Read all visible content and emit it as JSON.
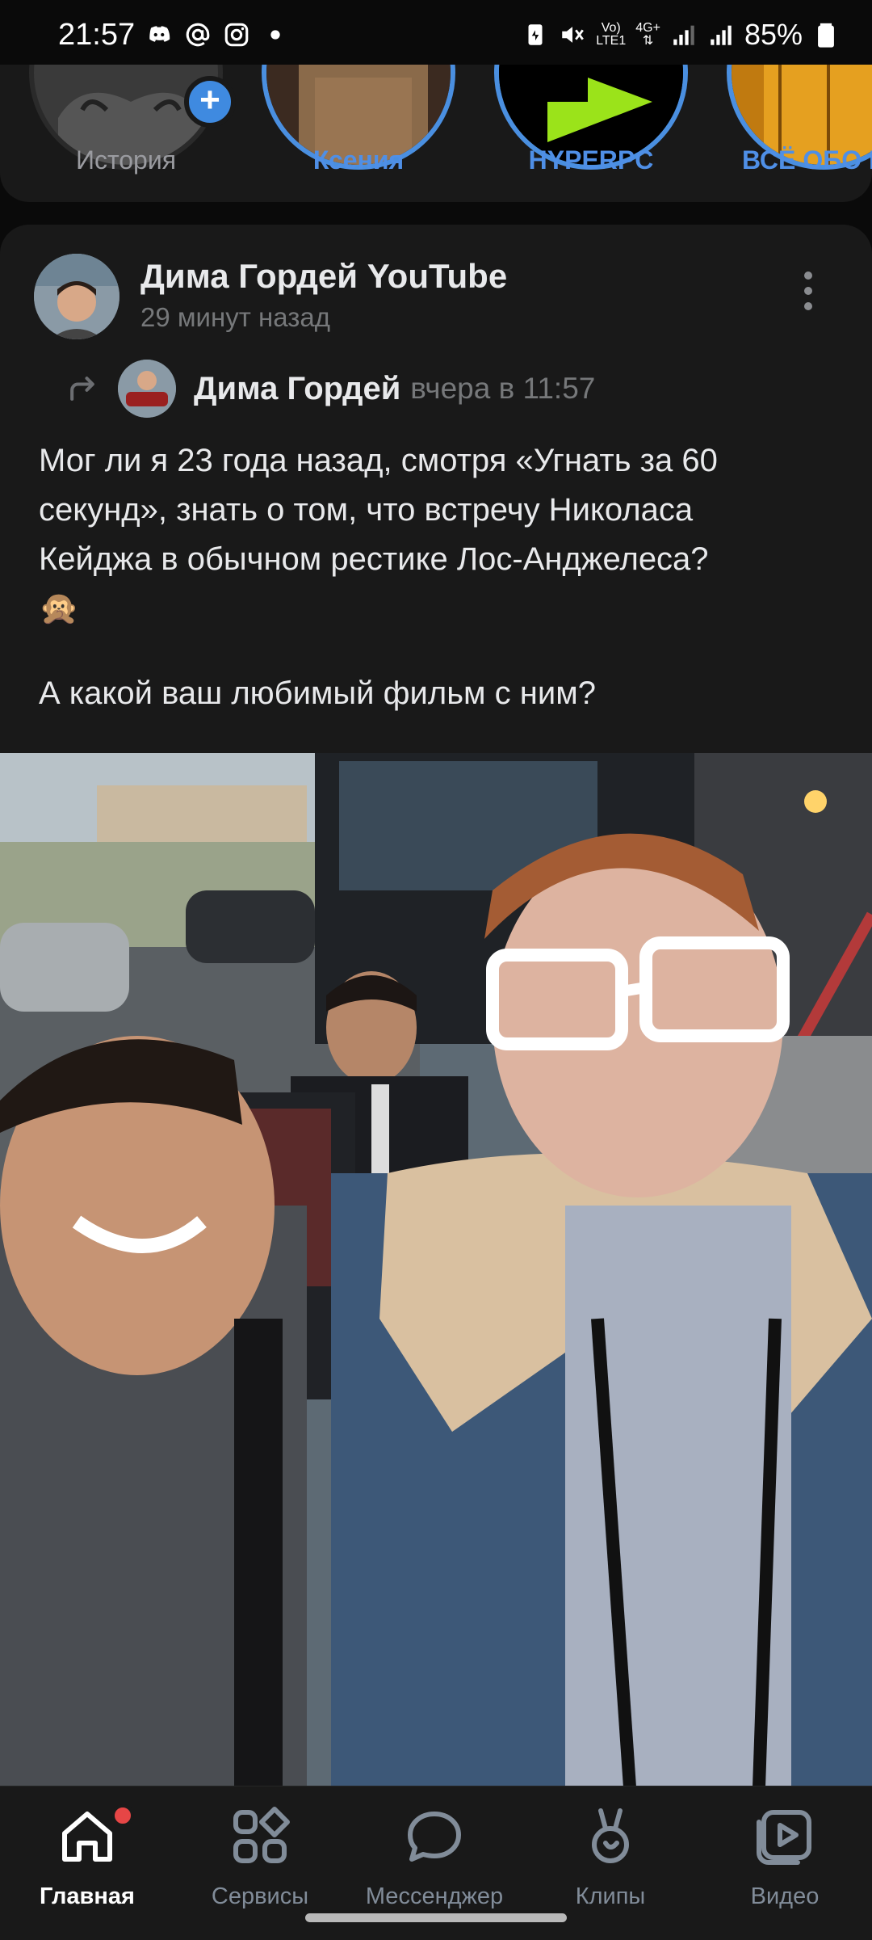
{
  "status_bar": {
    "time": "21:57",
    "network_top": "Vo)",
    "network_bottom": "LTE1",
    "net_type": "4G+",
    "battery": "85%",
    "left_icons": [
      "discord-icon",
      "at-icon",
      "instagram-icon",
      "dot-icon"
    ]
  },
  "stories": [
    {
      "label": "История",
      "kind": "own"
    },
    {
      "label": "Ксения",
      "kind": "friend"
    },
    {
      "label": "HYPERPC",
      "kind": "community"
    },
    {
      "label": "ВСЁ ОБО ВС",
      "kind": "community"
    }
  ],
  "post": {
    "author": "Дима Гордей YouTube",
    "time": "29 минут назад",
    "repost": {
      "author": "Дима Гордей",
      "time": "вчера в 11:57"
    },
    "text_lines": [
      "Мог ли я 23 года назад, смотря «Угнать за 60",
      "секунд», знать о том, что встречу Николаса",
      "Кейджа в обычном рестике Лос-Анджелеса?",
      "🙊"
    ],
    "text_question": "А какой ваш любимый фильм с ним?"
  },
  "nav": {
    "items": [
      {
        "label": "Главная",
        "icon": "home-icon",
        "active": true
      },
      {
        "label": "Сервисы",
        "icon": "services-icon",
        "active": false
      },
      {
        "label": "Мессенджер",
        "icon": "messenger-icon",
        "active": false
      },
      {
        "label": "Клипы",
        "icon": "clips-icon",
        "active": false
      },
      {
        "label": "Видео",
        "icon": "video-icon",
        "active": false
      }
    ]
  },
  "colors": {
    "accent": "#4f8fe6",
    "background": "#0a0a0a",
    "card": "#191919",
    "muted": "#76787a",
    "notification": "#e64646"
  }
}
